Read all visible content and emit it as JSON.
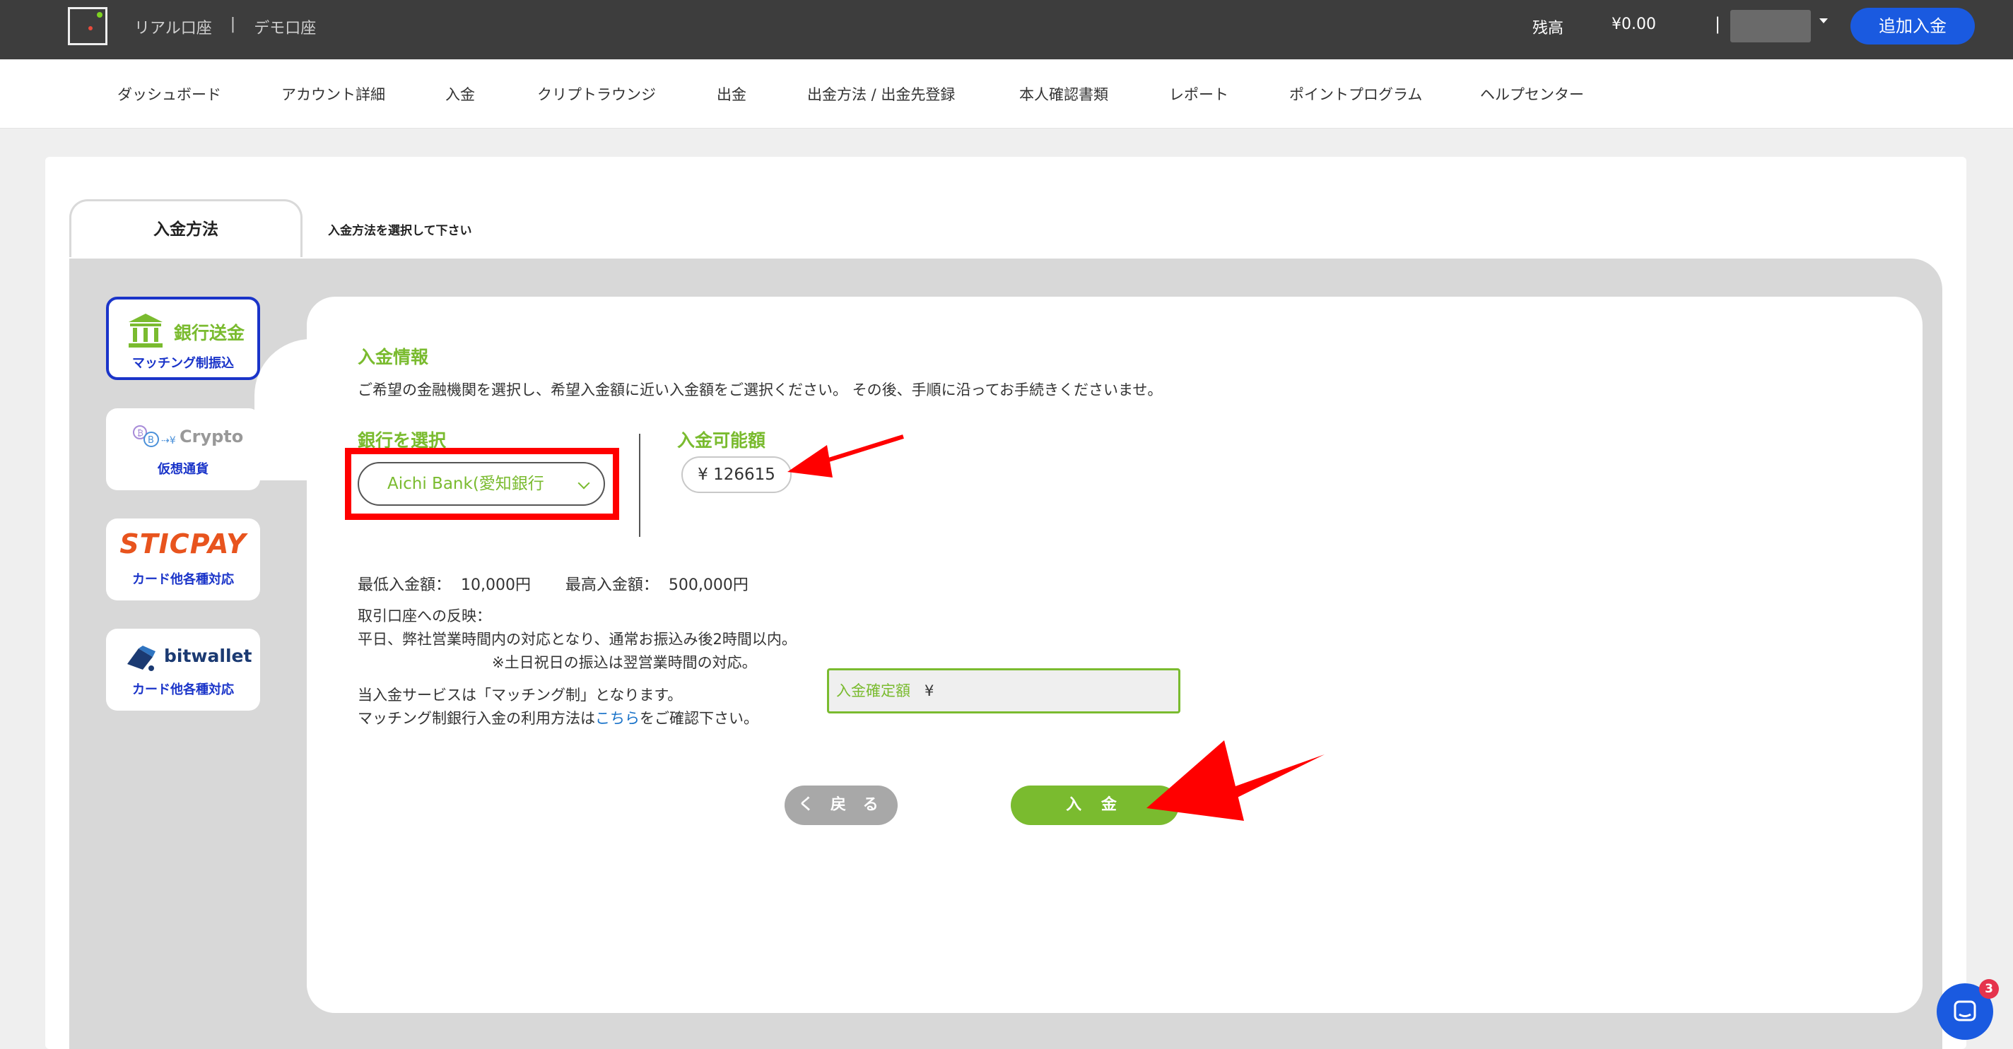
{
  "header": {
    "account_real": "リアル口座",
    "account_sep": "|",
    "account_demo": "デモ口座",
    "balance_label": "残高",
    "balance_value": "¥0.00",
    "pipe": "|",
    "add_deposit_label": "追加入金"
  },
  "nav": {
    "items": [
      "ダッシュボード",
      "アカウント詳細",
      "入金",
      "クリプトラウンジ",
      "出金",
      "出金方法 / 出金先登録",
      "本人確認書類",
      "レポート",
      "ポイントプログラム",
      "ヘルプセンター"
    ]
  },
  "tabs": {
    "active_label": "入金方法",
    "hint": "入金方法を選択して下さい"
  },
  "methods": {
    "bank": {
      "title": "銀行送金",
      "sub": "マッチング制振込",
      "icon": "bank-icon"
    },
    "crypto": {
      "title": "Crypto",
      "sub": "仮想通貨",
      "icon": "crypto-icon"
    },
    "sticpay": {
      "title": "STICPAY",
      "sub": "カード他各種対応"
    },
    "bitwallet": {
      "title": "bitwallet",
      "sub": "カード他各種対応",
      "icon": "bitwallet-icon"
    }
  },
  "form": {
    "section_title": "入金情報",
    "instruction": "ご希望の金融機関を選択し、希望入金額に近い入金額をご選択ください。 その後、手順に沿ってお手続きくださいませ。",
    "bank_label": "銀行を選択",
    "bank_selected": "Aichi Bank(愛知銀行",
    "available_label": "入金可能額",
    "available_value": "¥ 126615",
    "min_max": "最低入金額：  10,000円       最高入金額：  500,000円",
    "reflect_title": "取引口座への反映：",
    "reflect_line1": "平日、弊社営業時間内の対応となり、通常お振込み後2時間以内。",
    "reflect_line2": "※土日祝日の振込は翌営業時間の対応。",
    "service_line1": "当入金サービスは「マッチング制」となります。",
    "service_line2_pre": "マッチング制銀行入金の利用方法は",
    "service_link": "こちら",
    "service_line2_post": "をご確認下さい。",
    "confirm_label": "入金確定額",
    "confirm_yen": "¥",
    "back_label": "く 戻 る",
    "deposit_label": "入 金"
  },
  "chat": {
    "badge": "3"
  },
  "colors": {
    "accent_green": "#7abb2f",
    "primary_blue": "#1a5ae0",
    "annotation_red": "#ff0000",
    "topbar": "#3d3d3d"
  }
}
